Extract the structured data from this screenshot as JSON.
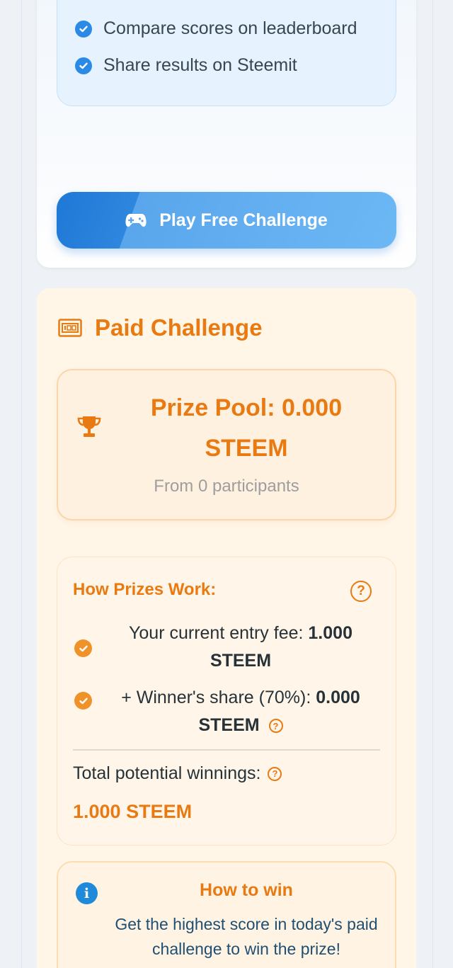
{
  "free_challenge": {
    "features": [
      "Compare scores on leaderboard",
      "Share results on Steemit"
    ],
    "play_button_label": "Play Free Challenge"
  },
  "paid_challenge": {
    "title": "Paid Challenge",
    "prize_pool_label": "Prize Pool: 0.000 STEEM",
    "participants_label": "From 0 participants",
    "how_prizes": {
      "title": "How Prizes Work:",
      "entry_fee_prefix": "Your current entry fee:",
      "entry_fee_value": "1.000 STEEM",
      "winner_share_prefix": "+ Winner's share (70%):",
      "winner_share_value": "0.000 STEEM",
      "total_label": "Total potential winnings:",
      "total_value": "1.000 STEEM"
    },
    "how_to_win": {
      "title": "How to win",
      "text": "Get the highest score in today's paid challenge to win the prize!"
    }
  },
  "colors": {
    "accent_blue": "#1e78d6",
    "accent_orange": "#e97a12"
  },
  "icons": {
    "feature_check": "check-circle-icon",
    "play": "gamepad-icon",
    "paid": "ticket-icon",
    "prize": "trophy-icon",
    "help": "question-circle-icon",
    "info": "info-icon"
  }
}
